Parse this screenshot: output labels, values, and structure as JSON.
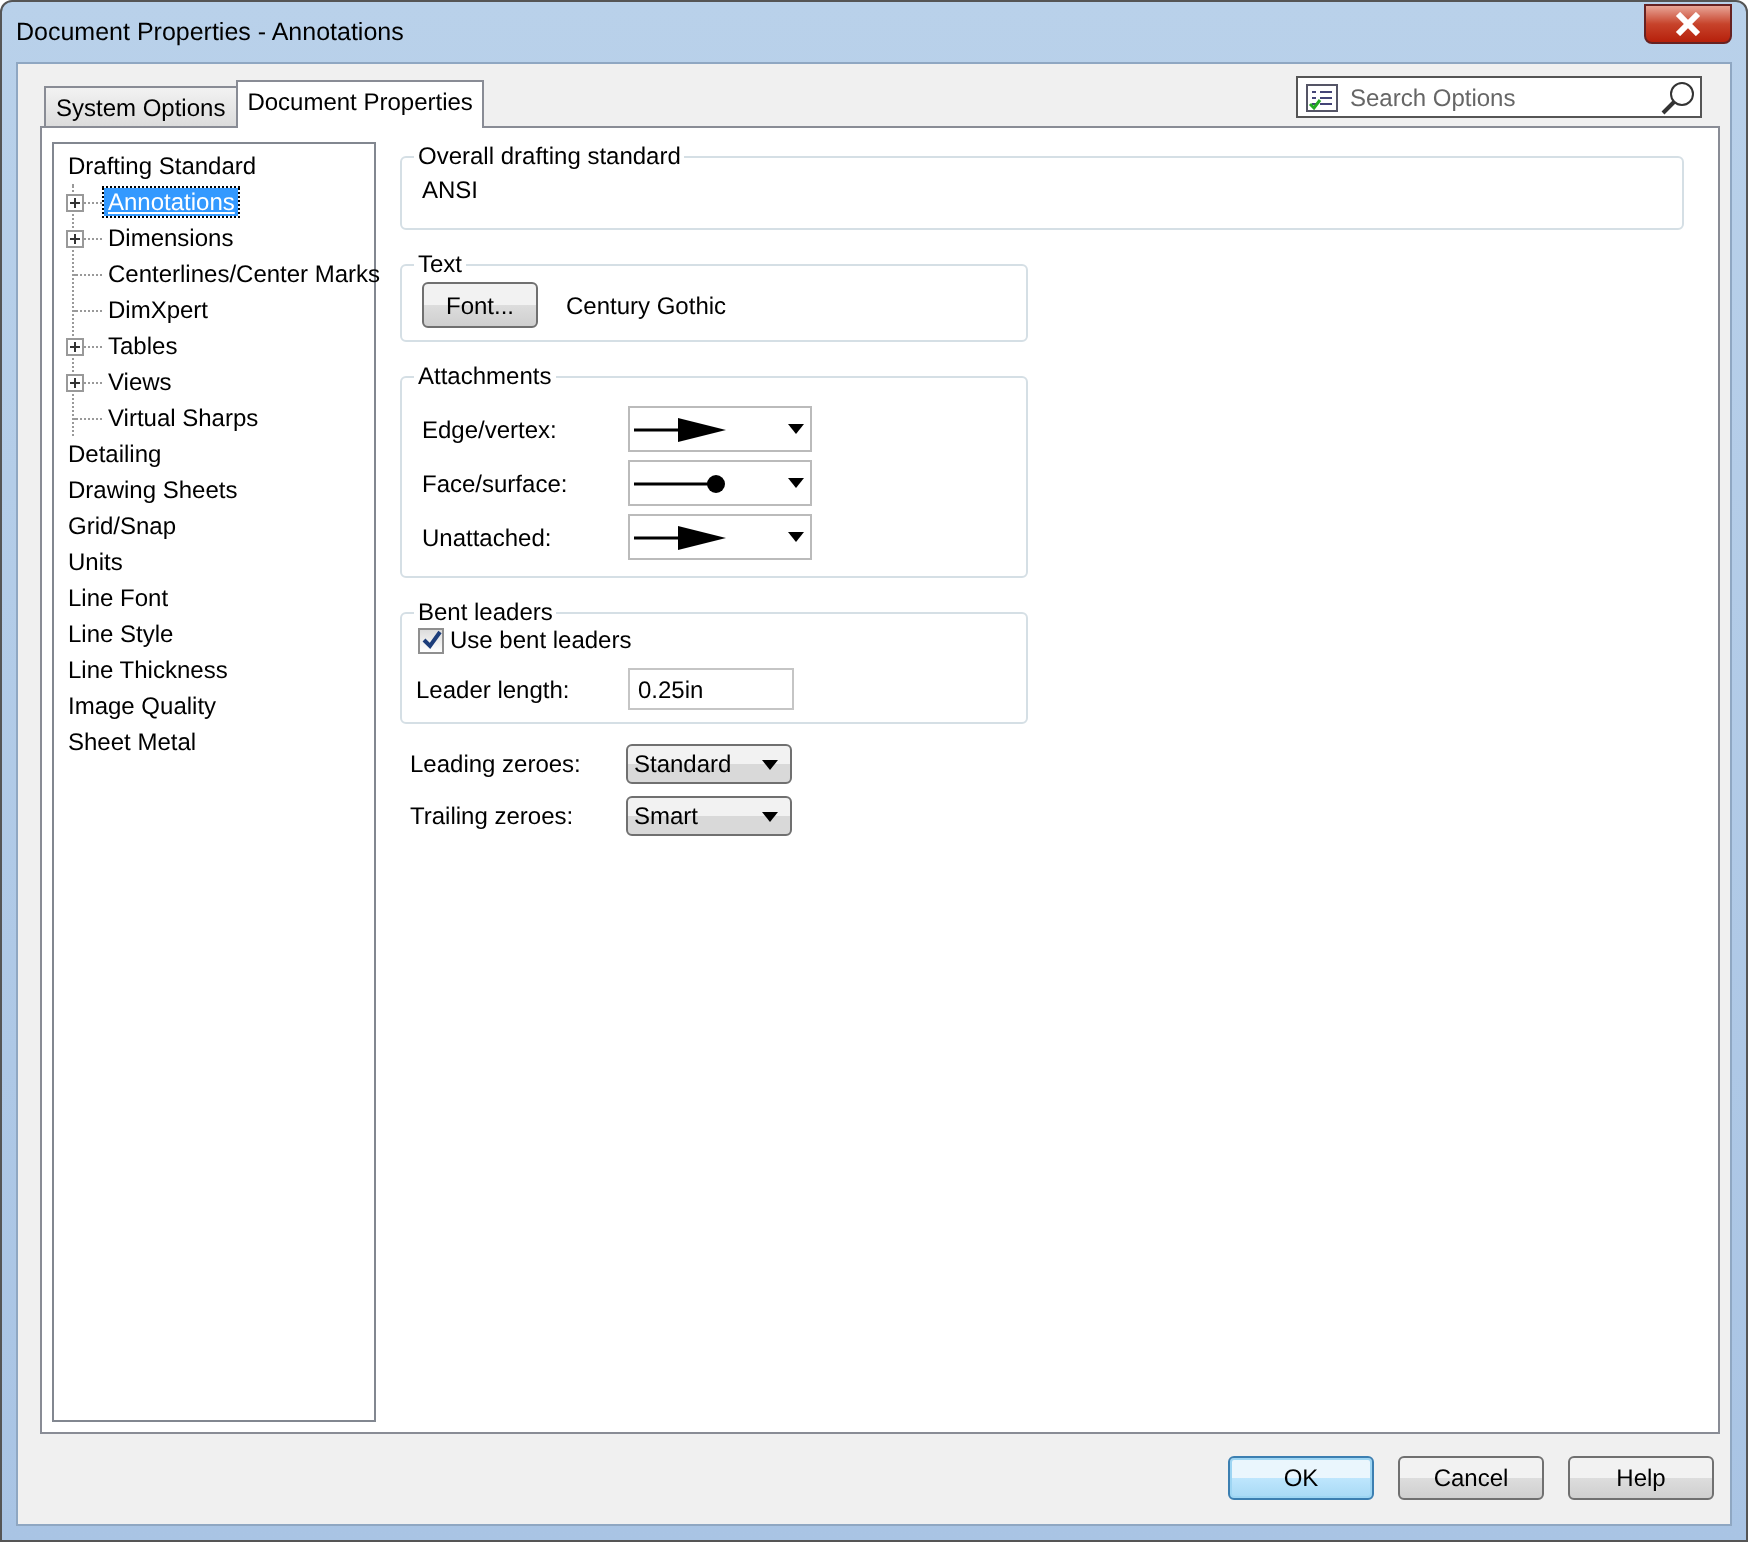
{
  "window": {
    "title": "Document Properties - Annotations"
  },
  "tabs": [
    {
      "label": "System Options",
      "selected": false
    },
    {
      "label": "Document Properties",
      "selected": true
    }
  ],
  "search": {
    "placeholder": "Search Options"
  },
  "tree": [
    {
      "label": "Drafting Standard",
      "selected": false,
      "children": [
        {
          "label": "Annotations",
          "selected": true,
          "expandable": true
        },
        {
          "label": "Dimensions",
          "selected": false,
          "expandable": true
        },
        {
          "label": "Centerlines/Center Marks",
          "selected": false,
          "expandable": false
        },
        {
          "label": "DimXpert",
          "selected": false,
          "expandable": false
        },
        {
          "label": "Tables",
          "selected": false,
          "expandable": true
        },
        {
          "label": "Views",
          "selected": false,
          "expandable": true
        },
        {
          "label": "Virtual Sharps",
          "selected": false,
          "expandable": false
        }
      ]
    },
    {
      "label": "Detailing",
      "selected": false
    },
    {
      "label": "Drawing Sheets",
      "selected": false
    },
    {
      "label": "Grid/Snap",
      "selected": false
    },
    {
      "label": "Units",
      "selected": false
    },
    {
      "label": "Line Font",
      "selected": false
    },
    {
      "label": "Line Style",
      "selected": false
    },
    {
      "label": "Line Thickness",
      "selected": false
    },
    {
      "label": "Image Quality",
      "selected": false
    },
    {
      "label": "Sheet Metal",
      "selected": false
    }
  ],
  "overall_standard": {
    "title": "Overall drafting standard",
    "value": "ANSI"
  },
  "text_group": {
    "title": "Text",
    "button": "Font...",
    "font": "Century Gothic"
  },
  "attachments": {
    "title": "Attachments",
    "rows": [
      {
        "label": "Edge/vertex:",
        "kind": "arrow"
      },
      {
        "label": "Face/surface:",
        "kind": "dot"
      },
      {
        "label": "Unattached:",
        "kind": "arrow"
      }
    ]
  },
  "bent_leaders": {
    "title": "Bent leaders",
    "checkbox": {
      "label": "Use bent leaders",
      "checked": true
    },
    "length_label": "Leader length:",
    "length_value": "0.25in"
  },
  "zeroes": [
    {
      "label": "Leading zeroes:",
      "value": "Standard"
    },
    {
      "label": "Trailing zeroes:",
      "value": "Smart"
    }
  ],
  "buttons": [
    {
      "label": "OK",
      "default": true
    },
    {
      "label": "Cancel",
      "default": false
    },
    {
      "label": "Help",
      "default": false
    }
  ]
}
